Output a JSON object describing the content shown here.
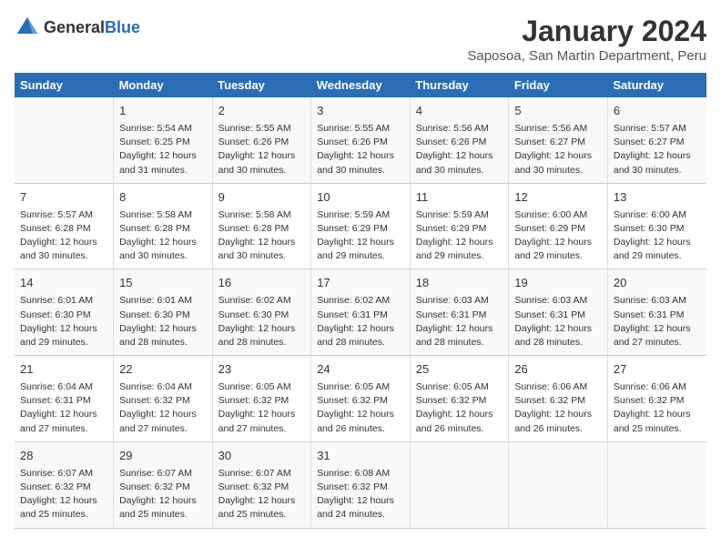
{
  "logo": {
    "general": "General",
    "blue": "Blue"
  },
  "title": "January 2024",
  "subtitle": "Saposoa, San Martin Department, Peru",
  "days_of_week": [
    "Sunday",
    "Monday",
    "Tuesday",
    "Wednesday",
    "Thursday",
    "Friday",
    "Saturday"
  ],
  "weeks": [
    [
      {
        "day": "",
        "info": ""
      },
      {
        "day": "1",
        "info": "Sunrise: 5:54 AM\nSunset: 6:25 PM\nDaylight: 12 hours\nand 31 minutes."
      },
      {
        "day": "2",
        "info": "Sunrise: 5:55 AM\nSunset: 6:26 PM\nDaylight: 12 hours\nand 30 minutes."
      },
      {
        "day": "3",
        "info": "Sunrise: 5:55 AM\nSunset: 6:26 PM\nDaylight: 12 hours\nand 30 minutes."
      },
      {
        "day": "4",
        "info": "Sunrise: 5:56 AM\nSunset: 6:26 PM\nDaylight: 12 hours\nand 30 minutes."
      },
      {
        "day": "5",
        "info": "Sunrise: 5:56 AM\nSunset: 6:27 PM\nDaylight: 12 hours\nand 30 minutes."
      },
      {
        "day": "6",
        "info": "Sunrise: 5:57 AM\nSunset: 6:27 PM\nDaylight: 12 hours\nand 30 minutes."
      }
    ],
    [
      {
        "day": "7",
        "info": "Sunrise: 5:57 AM\nSunset: 6:28 PM\nDaylight: 12 hours\nand 30 minutes."
      },
      {
        "day": "8",
        "info": "Sunrise: 5:58 AM\nSunset: 6:28 PM\nDaylight: 12 hours\nand 30 minutes."
      },
      {
        "day": "9",
        "info": "Sunrise: 5:58 AM\nSunset: 6:28 PM\nDaylight: 12 hours\nand 30 minutes."
      },
      {
        "day": "10",
        "info": "Sunrise: 5:59 AM\nSunset: 6:29 PM\nDaylight: 12 hours\nand 29 minutes."
      },
      {
        "day": "11",
        "info": "Sunrise: 5:59 AM\nSunset: 6:29 PM\nDaylight: 12 hours\nand 29 minutes."
      },
      {
        "day": "12",
        "info": "Sunrise: 6:00 AM\nSunset: 6:29 PM\nDaylight: 12 hours\nand 29 minutes."
      },
      {
        "day": "13",
        "info": "Sunrise: 6:00 AM\nSunset: 6:30 PM\nDaylight: 12 hours\nand 29 minutes."
      }
    ],
    [
      {
        "day": "14",
        "info": "Sunrise: 6:01 AM\nSunset: 6:30 PM\nDaylight: 12 hours\nand 29 minutes."
      },
      {
        "day": "15",
        "info": "Sunrise: 6:01 AM\nSunset: 6:30 PM\nDaylight: 12 hours\nand 28 minutes."
      },
      {
        "day": "16",
        "info": "Sunrise: 6:02 AM\nSunset: 6:30 PM\nDaylight: 12 hours\nand 28 minutes."
      },
      {
        "day": "17",
        "info": "Sunrise: 6:02 AM\nSunset: 6:31 PM\nDaylight: 12 hours\nand 28 minutes."
      },
      {
        "day": "18",
        "info": "Sunrise: 6:03 AM\nSunset: 6:31 PM\nDaylight: 12 hours\nand 28 minutes."
      },
      {
        "day": "19",
        "info": "Sunrise: 6:03 AM\nSunset: 6:31 PM\nDaylight: 12 hours\nand 28 minutes."
      },
      {
        "day": "20",
        "info": "Sunrise: 6:03 AM\nSunset: 6:31 PM\nDaylight: 12 hours\nand 27 minutes."
      }
    ],
    [
      {
        "day": "21",
        "info": "Sunrise: 6:04 AM\nSunset: 6:31 PM\nDaylight: 12 hours\nand 27 minutes."
      },
      {
        "day": "22",
        "info": "Sunrise: 6:04 AM\nSunset: 6:32 PM\nDaylight: 12 hours\nand 27 minutes."
      },
      {
        "day": "23",
        "info": "Sunrise: 6:05 AM\nSunset: 6:32 PM\nDaylight: 12 hours\nand 27 minutes."
      },
      {
        "day": "24",
        "info": "Sunrise: 6:05 AM\nSunset: 6:32 PM\nDaylight: 12 hours\nand 26 minutes."
      },
      {
        "day": "25",
        "info": "Sunrise: 6:05 AM\nSunset: 6:32 PM\nDaylight: 12 hours\nand 26 minutes."
      },
      {
        "day": "26",
        "info": "Sunrise: 6:06 AM\nSunset: 6:32 PM\nDaylight: 12 hours\nand 26 minutes."
      },
      {
        "day": "27",
        "info": "Sunrise: 6:06 AM\nSunset: 6:32 PM\nDaylight: 12 hours\nand 25 minutes."
      }
    ],
    [
      {
        "day": "28",
        "info": "Sunrise: 6:07 AM\nSunset: 6:32 PM\nDaylight: 12 hours\nand 25 minutes."
      },
      {
        "day": "29",
        "info": "Sunrise: 6:07 AM\nSunset: 6:32 PM\nDaylight: 12 hours\nand 25 minutes."
      },
      {
        "day": "30",
        "info": "Sunrise: 6:07 AM\nSunset: 6:32 PM\nDaylight: 12 hours\nand 25 minutes."
      },
      {
        "day": "31",
        "info": "Sunrise: 6:08 AM\nSunset: 6:32 PM\nDaylight: 12 hours\nand 24 minutes."
      },
      {
        "day": "",
        "info": ""
      },
      {
        "day": "",
        "info": ""
      },
      {
        "day": "",
        "info": ""
      }
    ]
  ]
}
